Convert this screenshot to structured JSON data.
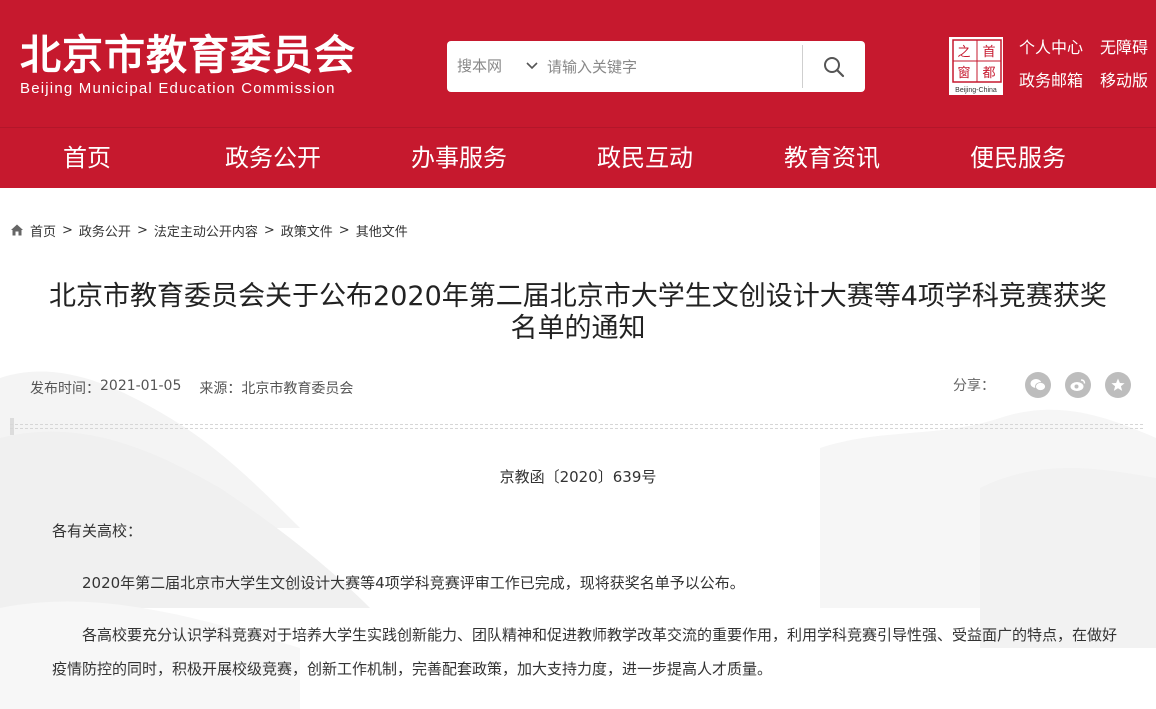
{
  "header": {
    "logo_cn": "北京市教育委员会",
    "logo_en": "Beijing Municipal Education Commission",
    "search": {
      "scope": "搜本网",
      "placeholder": "请输入关键字"
    },
    "seal": {
      "chars": [
        "之",
        "首",
        "都",
        "窗"
      ],
      "caption": "Beijing-China"
    },
    "links": {
      "personal_center": "个人中心",
      "accessibility": "无障碍",
      "gov_mail": "政务邮箱",
      "mobile": "移动版"
    }
  },
  "nav": {
    "items": [
      "首页",
      "政务公开",
      "办事服务",
      "政民互动",
      "教育资讯",
      "便民服务"
    ]
  },
  "breadcrumb": {
    "items": [
      "首页",
      "政务公开",
      "法定主动公开内容",
      "政策文件",
      "其他文件"
    ],
    "separator": ">"
  },
  "article": {
    "title_line1": "北京市教育委员会关于公布2020年第二届北京市大学生文创设计大赛等4项学科竞赛获奖",
    "title_line2": "名单的通知",
    "publish_label": "发布时间：",
    "publish_date": "2021-01-05",
    "source_label": "来源：",
    "source": "北京市教育委员会",
    "share_label": "分享：",
    "doc_number": "京教函〔2020〕639号",
    "salutation": "各有关高校：",
    "paragraphs": [
      "2020年第二届北京市大学生文创设计大赛等4项学科竞赛评审工作已完成，现将获奖名单予以公布。",
      "各高校要充分认识学科竞赛对于培养大学生实践创新能力、团队精神和促进教师教学改革交流的重要作用，利用学科竞赛引导性强、受益面广的特点，在做好疫情防控的同时，积极开展校级竞赛，创新工作机制，完善配套政策，加大支持力度，进一步提高人才质量。"
    ]
  },
  "colors": {
    "brand_red": "#c6192e",
    "text": "#333333",
    "share_icon_bg": "#bdbdbd"
  }
}
